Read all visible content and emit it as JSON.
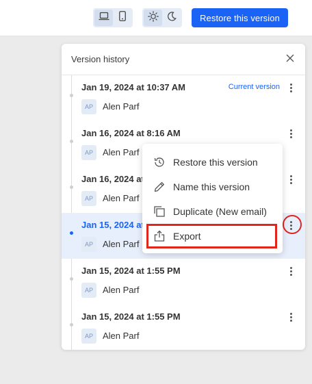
{
  "topbar": {
    "device_icons": [
      "laptop-icon",
      "phone-icon"
    ],
    "theme_icons": [
      "sun-icon",
      "moon-icon"
    ],
    "restore_button": "Restore this version",
    "accent_color": "#1a63f5"
  },
  "panel": {
    "title": "Version history"
  },
  "entries": [
    {
      "date": "Jan 19, 2024 at 10:37 AM",
      "current_label": "Current version",
      "initials": "AP",
      "author": "Alen Parf"
    },
    {
      "date": "Jan 16, 2024 at 8:16 AM",
      "initials": "AP",
      "author": "Alen Parf"
    },
    {
      "date": "Jan 16, 2024 at 8:13 AM",
      "initials": "AP",
      "author": "Alen Parf"
    },
    {
      "date": "Jan 15, 2024 at 2:52 PM",
      "initials": "AP",
      "author": "Alen Parf",
      "selected": true
    },
    {
      "date": "Jan 15, 2024 at 1:55 PM",
      "initials": "AP",
      "author": "Alen Parf"
    },
    {
      "date": "Jan 15, 2024 at 1:55 PM",
      "initials": "AP",
      "author": "Alen Parf"
    }
  ],
  "context_menu": {
    "items": [
      {
        "label": "Restore this version",
        "icon": "restore-icon"
      },
      {
        "label": "Name this version",
        "icon": "pencil-icon"
      },
      {
        "label": "Duplicate (New email)",
        "icon": "duplicate-icon"
      },
      {
        "label": "Export",
        "icon": "export-icon"
      }
    ]
  },
  "annotation_color": "#e0251b"
}
